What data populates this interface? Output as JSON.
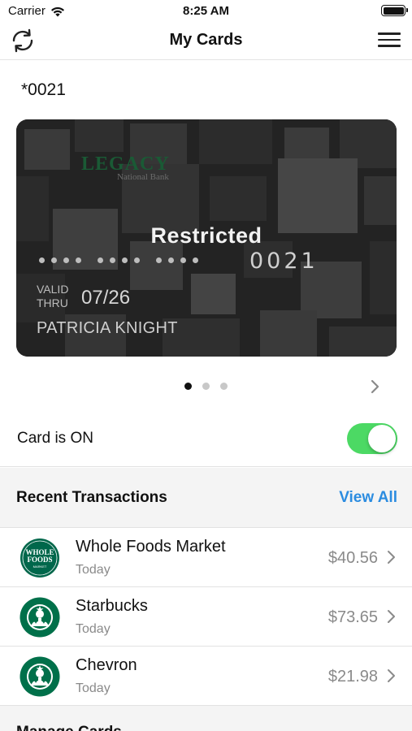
{
  "status_bar": {
    "carrier": "Carrier",
    "time": "8:25 AM",
    "wifi_icon": "wifi-icon",
    "battery_icon": "battery-icon"
  },
  "nav": {
    "title": "My Cards",
    "left_icon": "refresh-icon",
    "right_icon": "hamburger-menu-icon"
  },
  "card": {
    "number_label": "*0021",
    "bank_logo_text": "LEGACY",
    "bank_logo_subtext": "National Bank",
    "status": "Restricted",
    "last4": "0021",
    "valid_thru_label_1": "VALID",
    "valid_thru_label_2": "THRU",
    "expiry": "07/26",
    "holder": "PATRICIA KNIGHT"
  },
  "pager": {
    "count": 3,
    "active_index": 0,
    "next_icon": "chevron-right-icon"
  },
  "card_toggle": {
    "label": "Card is ON",
    "on": true,
    "color": "#4cd964"
  },
  "transactions": {
    "title": "Recent Transactions",
    "view_all": "View All",
    "link_color": "#2b8ce0",
    "items": [
      {
        "merchant": "Whole Foods Market",
        "date": "Today",
        "amount": "$40.56",
        "logo": "whole-foods-logo",
        "logo_text_1": "WHOLE",
        "logo_text_2": "FOODS",
        "logo_text_3": "MARKET"
      },
      {
        "merchant": "Starbucks",
        "date": "Today",
        "amount": "$73.65",
        "logo": "starbucks-logo"
      },
      {
        "merchant": "Chevron",
        "date": "Today",
        "amount": "$21.98",
        "logo": "starbucks-logo"
      }
    ]
  },
  "bottom_section": {
    "title": "Manage Cards"
  }
}
